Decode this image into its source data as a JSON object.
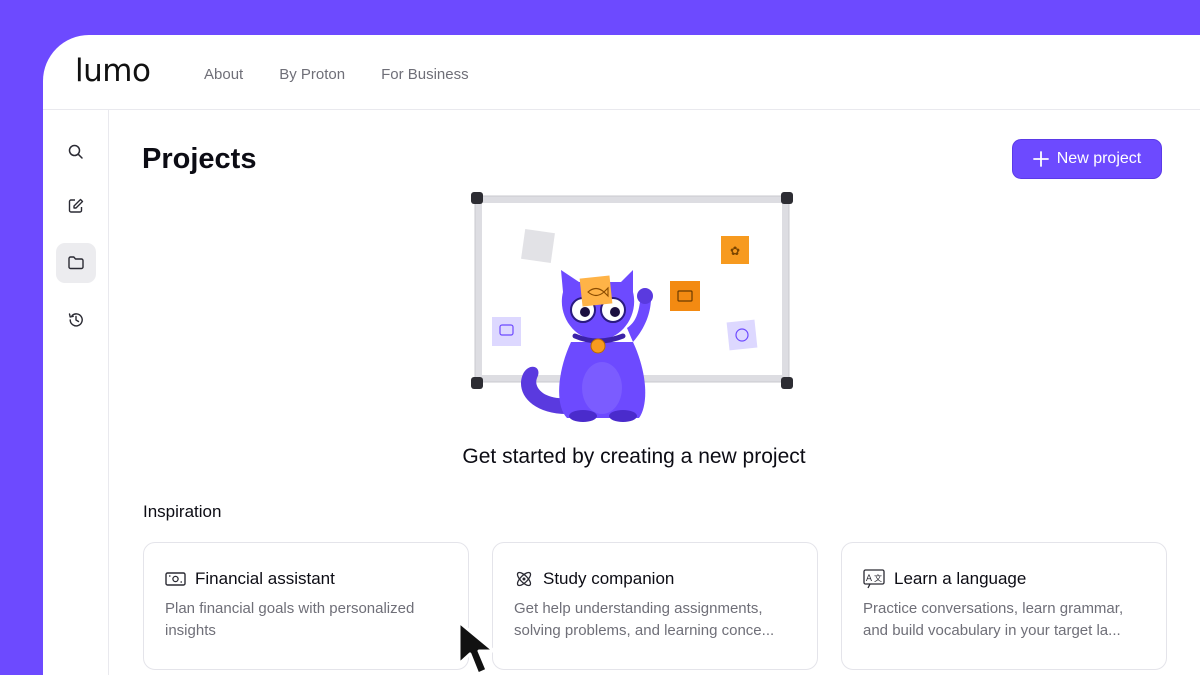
{
  "app": {
    "logo": "lumo",
    "nav": [
      "About",
      "By Proton",
      "For Business"
    ]
  },
  "sidebar": {
    "items": [
      {
        "name": "search",
        "icon": "search-icon"
      },
      {
        "name": "new-chat",
        "icon": "edit-icon"
      },
      {
        "name": "projects",
        "icon": "folder-icon",
        "active": true
      },
      {
        "name": "history",
        "icon": "history-icon"
      }
    ]
  },
  "main": {
    "title": "Projects",
    "new_project_label": "New project",
    "empty_message": "Get started by creating a new project",
    "inspiration_title": "Inspiration",
    "cards": [
      {
        "icon": "money-icon",
        "title": "Financial assistant",
        "line1": "Plan financial goals with personalized",
        "line2": "insights"
      },
      {
        "icon": "atom-icon",
        "title": "Study companion",
        "line1": "Get help understanding assignments,",
        "line2": "solving problems, and learning conce..."
      },
      {
        "icon": "translate-icon",
        "title": "Learn a language",
        "line1": "Practice conversations, learn grammar,",
        "line2": "and build vocabulary in your target la..."
      }
    ]
  },
  "colors": {
    "brand": "#6d4aff",
    "sticky_orange": "#f79a1f",
    "sticky_yellow": "#ffb347",
    "cat": "#6d4aff"
  }
}
